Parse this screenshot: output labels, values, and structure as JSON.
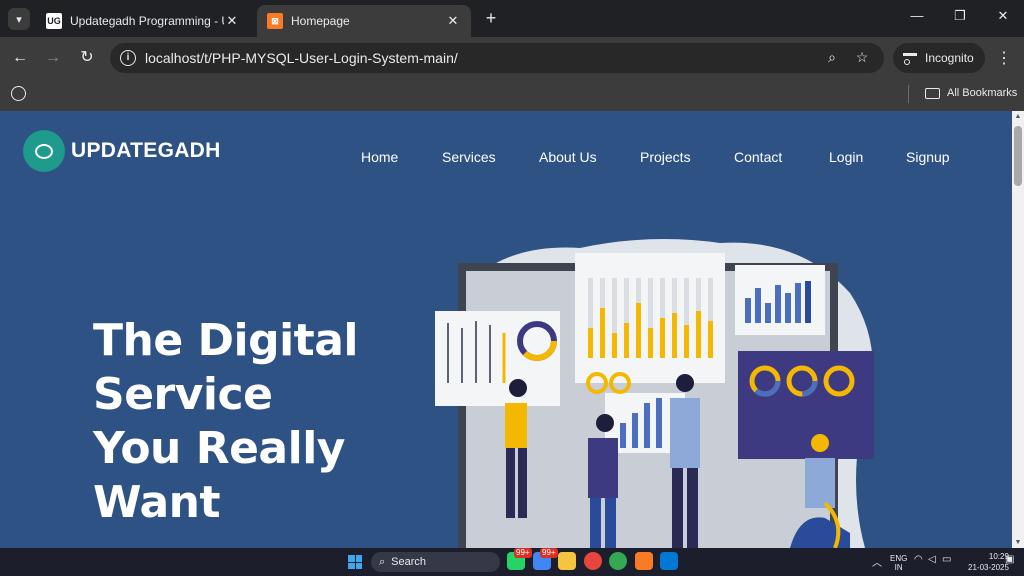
{
  "browser": {
    "tabs": [
      {
        "title": "Updategadh Programming - Upda",
        "favicon": "UG"
      },
      {
        "title": "Homepage",
        "favicon": "XAMPP"
      }
    ],
    "url": "localhost/t/PHP-MYSQL-User-Login-System-main/",
    "incognito_label": "Incognito",
    "bookmarks_label": "All Bookmarks"
  },
  "site": {
    "logo_text": "UPDATEGADH",
    "nav": [
      "Home",
      "Services",
      "About Us",
      "Projects",
      "Contact",
      "Login",
      "Signup"
    ],
    "hero_lines": [
      "The Digital",
      "Service",
      "You Really",
      "Want"
    ]
  },
  "taskbar": {
    "search_label": "Search",
    "badge": "99+",
    "lang": "ENG",
    "region": "IN",
    "time": "10:29",
    "date": "21-03-2025"
  },
  "colors": {
    "page_bg": "#2d5283",
    "logo_accent": "#1e9b8c",
    "chart_yellow": "#f5b800",
    "chart_blue": "#4a6fc0",
    "dark_panel": "#3d3a82"
  }
}
